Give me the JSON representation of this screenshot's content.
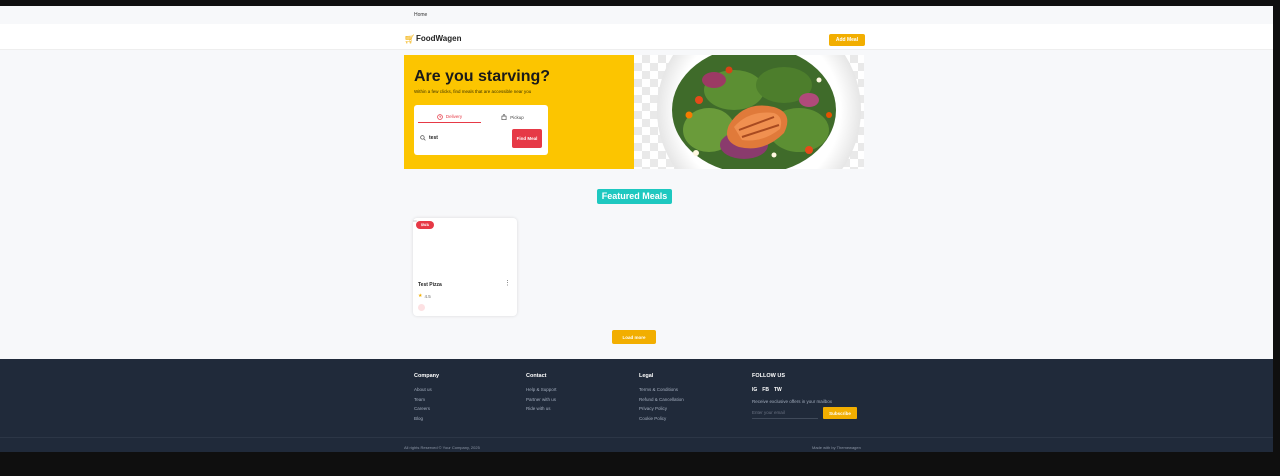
{
  "breadcrumb": "Home",
  "brand": {
    "name": "FoodWagen",
    "logo_icon": "cart-icon",
    "accent": "#f2ae00"
  },
  "header": {
    "add_meal_label": "Add Meal"
  },
  "hero": {
    "title": "Are you starving?",
    "subtitle": "Within a few clicks, find meals that are accessible near you",
    "tabs": [
      {
        "label": "Delivery",
        "icon": "clock-icon",
        "active": true
      },
      {
        "label": "Pickup",
        "icon": "bag-icon",
        "active": false
      }
    ],
    "search_value": "test",
    "find_button": "Find Meal",
    "background": "#fcc500"
  },
  "featured": {
    "title": "Featured Meals",
    "color": "#1ec8c0"
  },
  "meals": [
    {
      "price": "$N/A",
      "name": "Test Pizza",
      "rating": "4.5"
    }
  ],
  "load_more_label": "Load more",
  "footer": {
    "columns": [
      {
        "title": "Company",
        "links": [
          "About us",
          "Team",
          "Careers",
          "Blog"
        ]
      },
      {
        "title": "Contact",
        "links": [
          "Help & Support",
          "Partner with us",
          "Ride with us"
        ]
      },
      {
        "title": "Legal",
        "links": [
          "Terms & Conditions",
          "Refund & Cancellation",
          "Privacy Policy",
          "Cookie Policy"
        ]
      }
    ],
    "follow": {
      "title": "FOLLOW US",
      "social": [
        "IG",
        "FB",
        "TW"
      ],
      "promo": "Receive exclusive offers in your mailbox",
      "email_placeholder": "Enter your email",
      "subscribe_label": "Subscribe"
    },
    "copyright": "All rights Reserved © Your Company, 2025",
    "made_with": "Made with by Themewagen"
  }
}
